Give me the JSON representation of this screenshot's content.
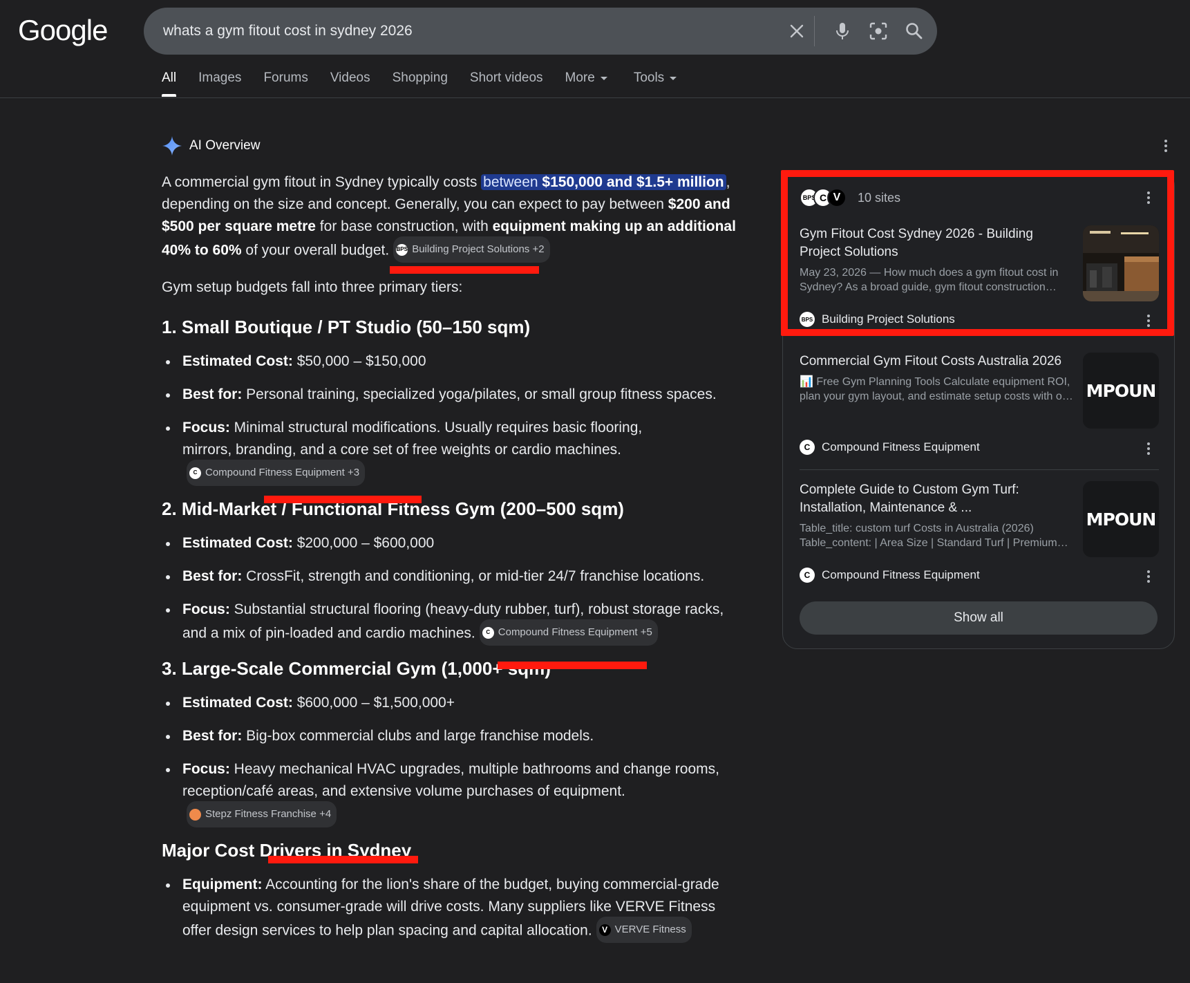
{
  "header": {
    "logo": "Google",
    "search_query": "whats a gym fitout cost in sydney 2026",
    "tabs": [
      {
        "label": "All"
      },
      {
        "label": "Images"
      },
      {
        "label": "Forums"
      },
      {
        "label": "Videos"
      },
      {
        "label": "Shopping"
      },
      {
        "label": "Short videos"
      },
      {
        "label": "More"
      },
      {
        "label": "Tools"
      }
    ],
    "icons": [
      "clear-icon",
      "mic-icon",
      "lens-icon",
      "search-icon"
    ]
  },
  "ai_overview": {
    "label": "AI Overview",
    "intro": {
      "t1": "A commercial gym fitout in Sydney typically costs ",
      "hl_pre": "between ",
      "hl_bold": "$150,000 and $1.5+ million",
      "t2": ", depending on the size and concept. Generally, you can expect to pay between ",
      "b1": "$200 and $500 per square metre",
      "t3": " for base construction, with ",
      "b2": "equipment making up an additional 40% to 60%",
      "t4": " of your overall budget.",
      "chip": "Building Project Solutions +2"
    },
    "tiers_intro": "Gym setup budgets fall into three primary tiers:",
    "tiers": [
      {
        "heading": "1. Small Boutique / PT Studio (50–150 sqm)",
        "items": [
          {
            "label": "Estimated Cost:",
            "text": " $50,000 – $150,000"
          },
          {
            "label": "Best for:",
            "text": " Personal training, specialized yoga/pilates, or small group fitness spaces."
          },
          {
            "label": "Focus:",
            "text": " Minimal structural modifications. Usually requires basic flooring, mirrors, branding, and a core set of free weights or cardio machines.",
            "chip": "Compound Fitness Equipment +3"
          }
        ]
      },
      {
        "heading": "2. Mid-Market / Functional Fitness Gym (200–500 sqm)",
        "items": [
          {
            "label": "Estimated Cost:",
            "text": " $200,000 – $600,000"
          },
          {
            "label": "Best for:",
            "text": " CrossFit, strength and conditioning, or mid-tier 24/7 franchise locations."
          },
          {
            "label": "Focus:",
            "text": " Substantial structural flooring (heavy-duty rubber, turf), robust storage racks, and a mix of pin-loaded and cardio machines.",
            "chip": "Compound Fitness Equipment +5"
          }
        ]
      },
      {
        "heading": "3. Large-Scale Commercial Gym (1,000+ sqm)",
        "items": [
          {
            "label": "Estimated Cost:",
            "text": " $600,000 – $1,500,000+"
          },
          {
            "label": "Best for:",
            "text": " Big-box commercial clubs and large franchise models."
          },
          {
            "label": "Focus:",
            "text": " Heavy mechanical HVAC upgrades, multiple bathrooms and change rooms, reception/café areas, and extensive volume purchases of equipment.",
            "chip": "Stepz Fitness Franchise +4"
          }
        ]
      }
    ],
    "drivers": {
      "heading": "Major Cost Drivers in Sydney",
      "items": [
        {
          "label": "Equipment:",
          "text": " Accounting for the lion's share of the budget, buying commercial-grade equipment vs. consumer-grade will drive costs. Many suppliers like VERVE Fitness offer design services to help plan spacing and capital allocation.",
          "chip": "VERVE Fitness"
        }
      ]
    }
  },
  "sources_panel": {
    "sites_count": "10 sites",
    "favicons": [
      "BPS",
      "C",
      "V"
    ],
    "cards": [
      {
        "title": "Gym Fitout Cost Sydney 2026 - Building Project Solutions",
        "snippet": "May 23, 2026 — How much does a gym fitout cost in Sydney? As a broad guide, gym fitout construction…",
        "source": "Building Project Solutions",
        "source_icon": "BPS",
        "thumb_text": ""
      },
      {
        "title": "Commercial Gym Fitout Costs Australia 2026",
        "snippet": "📊 Free Gym Planning Tools Calculate equipment ROI, plan your gym layout, and estimate setup costs with o…",
        "source": "Compound Fitness Equipment",
        "source_icon": "C",
        "thumb_text": "MPOUN"
      },
      {
        "title": "Complete Guide to Custom Gym Turf: Installation, Maintenance & ...",
        "snippet": "Table_title: custom turf Costs in Australia (2026) Table_content: | Area Size | Standard Turf | Premium…",
        "source": "Compound Fitness Equipment",
        "source_icon": "C",
        "thumb_text": "MPOUN"
      }
    ],
    "show_all": "Show all"
  },
  "colors": {
    "background": "#1f1f21",
    "highlight": "#1f3a8f",
    "annotation_red": "#ff1a0e"
  }
}
